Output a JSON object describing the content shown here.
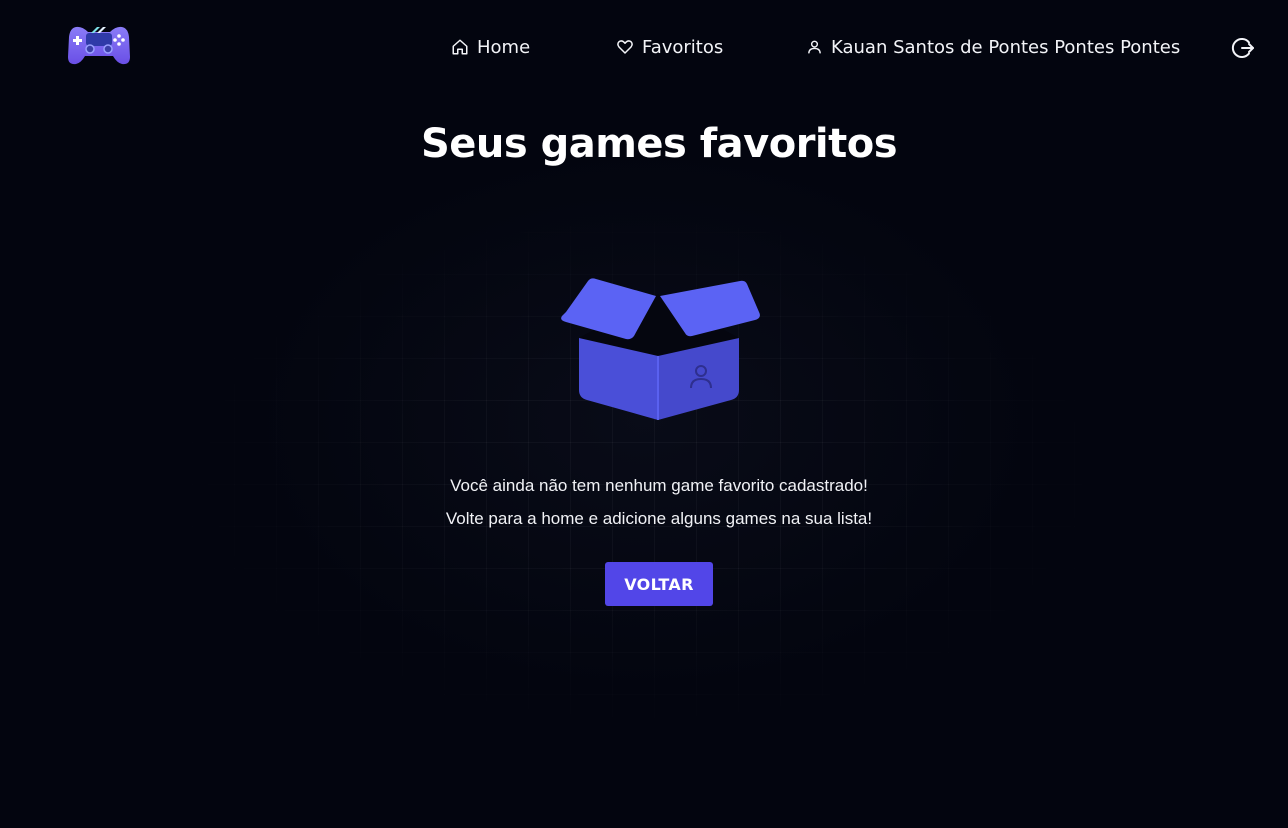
{
  "header": {
    "nav": {
      "home_label": "Home",
      "favorites_label": "Favoritos",
      "user_name": "Kauan Santos de Pontes Pontes Pontes"
    },
    "icons": {
      "logo": "gamepad-logo",
      "home": "home-icon",
      "favorites": "heart-icon",
      "user": "user-icon",
      "logout": "logout-icon"
    }
  },
  "main": {
    "title": "Seus games favoritos",
    "empty_illustration": "open-box-icon",
    "message_line1": "Você ainda não tem nenhum game favorito cadastrado!",
    "message_line2": "Volte para a home e adicione alguns games na sua lista!",
    "back_button_label": "VOLTAR"
  },
  "colors": {
    "background": "#03050f",
    "accent": "#5246e8",
    "box_flap": "#5b63f4",
    "box_body": "#4a4fd8",
    "text": "#ffffff"
  }
}
